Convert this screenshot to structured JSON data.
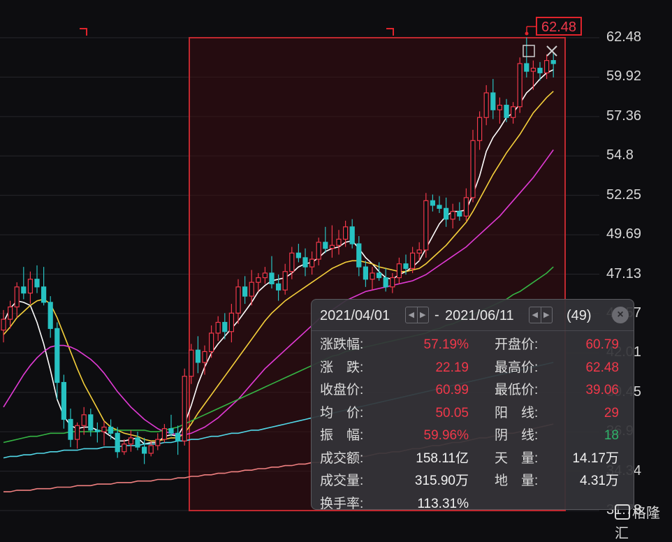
{
  "chart_data": {
    "type": "candlestick",
    "y_axis_ticks": [
      "62.48",
      "59.92",
      "57.36",
      "54.8",
      "52.25",
      "49.69",
      "47.13",
      "44.57",
      "42.01",
      "39.45",
      "36.9",
      "34.34",
      "31.78"
    ],
    "ylim": [
      31.78,
      62.48
    ],
    "max_marker": "62.48",
    "selection_range": {
      "start": "2021/04/01",
      "end": "2021/06/11"
    },
    "candles": [
      [
        43.5,
        44.8,
        42.7,
        44.2
      ],
      [
        44.2,
        45.4,
        43.6,
        45.0
      ],
      [
        45.0,
        46.6,
        44.3,
        46.3
      ],
      [
        46.3,
        47.6,
        45.5,
        45.9
      ],
      [
        45.9,
        47.3,
        45.2,
        46.8
      ],
      [
        46.8,
        47.7,
        45.9,
        46.3
      ],
      [
        46.3,
        47.6,
        45.1,
        45.3
      ],
      [
        45.3,
        45.7,
        43.0,
        43.6
      ],
      [
        43.6,
        44.0,
        39.0,
        40.1
      ],
      [
        40.1,
        40.6,
        37.1,
        37.7
      ],
      [
        37.7,
        38.4,
        35.9,
        36.4
      ],
      [
        36.4,
        37.5,
        35.8,
        37.3
      ],
      [
        37.3,
        38.5,
        36.7,
        38.0
      ],
      [
        38.0,
        38.4,
        36.6,
        37.0
      ],
      [
        37.0,
        37.5,
        36.2,
        36.9
      ],
      [
        36.9,
        37.6,
        36.0,
        37.2
      ],
      [
        37.2,
        37.7,
        36.4,
        36.8
      ],
      [
        36.8,
        37.2,
        35.2,
        35.6
      ],
      [
        35.6,
        36.4,
        35.4,
        36.1
      ],
      [
        36.1,
        37.0,
        35.6,
        36.5
      ],
      [
        36.5,
        36.9,
        35.7,
        35.9
      ],
      [
        35.9,
        36.5,
        34.8,
        35.5
      ],
      [
        35.5,
        36.3,
        35.3,
        36.0
      ],
      [
        36.0,
        36.8,
        35.7,
        36.4
      ],
      [
        36.4,
        37.4,
        36.2,
        37.1
      ],
      [
        37.1,
        38.0,
        36.6,
        36.8
      ],
      [
        36.8,
        37.3,
        35.4,
        36.3
      ],
      [
        36.3,
        41.0,
        36.0,
        40.5
      ],
      [
        40.5,
        42.6,
        40.0,
        42.2
      ],
      [
        42.2,
        43.1,
        40.7,
        41.4
      ],
      [
        41.4,
        42.5,
        40.6,
        42.1
      ],
      [
        42.1,
        43.8,
        41.7,
        43.3
      ],
      [
        43.3,
        44.4,
        42.8,
        44.0
      ],
      [
        44.0,
        44.6,
        42.9,
        43.4
      ],
      [
        43.4,
        45.2,
        42.7,
        44.6
      ],
      [
        44.6,
        46.8,
        43.9,
        46.3
      ],
      [
        46.3,
        47.0,
        45.2,
        45.7
      ],
      [
        45.7,
        47.4,
        45.1,
        46.6
      ],
      [
        46.6,
        47.2,
        46.0,
        46.9
      ],
      [
        46.9,
        47.6,
        46.5,
        47.2
      ],
      [
        47.2,
        48.3,
        46.2,
        46.5
      ],
      [
        46.5,
        47.1,
        45.4,
        46.1
      ],
      [
        46.1,
        47.8,
        45.8,
        47.3
      ],
      [
        47.3,
        48.9,
        46.8,
        48.5
      ],
      [
        48.5,
        49.1,
        47.9,
        48.2
      ],
      [
        48.2,
        48.8,
        47.0,
        47.6
      ],
      [
        47.6,
        48.6,
        47.1,
        48.1
      ],
      [
        48.1,
        49.5,
        47.7,
        49.2
      ],
      [
        49.2,
        50.2,
        48.5,
        48.8
      ],
      [
        48.8,
        50.3,
        48.2,
        49.0
      ],
      [
        49.0,
        50.0,
        48.4,
        49.4
      ],
      [
        49.4,
        50.6,
        48.9,
        50.2
      ],
      [
        50.2,
        50.7,
        48.8,
        49.1
      ],
      [
        49.1,
        49.6,
        47.0,
        47.6
      ],
      [
        47.6,
        48.0,
        46.3,
        46.8
      ],
      [
        46.8,
        47.6,
        46.1,
        47.2
      ],
      [
        47.2,
        47.9,
        46.7,
        46.9
      ],
      [
        46.9,
        47.5,
        46.0,
        46.3
      ],
      [
        46.3,
        47.2,
        45.9,
        46.9
      ],
      [
        46.9,
        48.2,
        46.5,
        47.8
      ],
      [
        47.8,
        48.4,
        47.1,
        47.5
      ],
      [
        47.5,
        48.9,
        47.2,
        48.5
      ],
      [
        48.5,
        49.2,
        48.0,
        48.7
      ],
      [
        48.7,
        52.4,
        48.2,
        51.9
      ],
      [
        51.9,
        52.3,
        51.2,
        51.6
      ],
      [
        51.6,
        52.2,
        51.1,
        51.4
      ],
      [
        51.4,
        52.1,
        50.2,
        50.7
      ],
      [
        50.7,
        51.7,
        50.1,
        51.2
      ],
      [
        51.2,
        51.8,
        50.6,
        50.9
      ],
      [
        50.9,
        52.7,
        50.6,
        52.1
      ],
      [
        52.1,
        56.5,
        51.8,
        55.8
      ],
      [
        55.8,
        57.7,
        55.2,
        57.3
      ],
      [
        57.3,
        59.4,
        56.8,
        58.9
      ],
      [
        58.9,
        59.8,
        57.2,
        57.8
      ],
      [
        57.8,
        58.6,
        56.9,
        58.1
      ],
      [
        58.1,
        58.5,
        57.0,
        57.3
      ],
      [
        57.3,
        58.3,
        56.9,
        58.0
      ],
      [
        58.0,
        61.2,
        57.6,
        60.8
      ],
      [
        60.8,
        62.5,
        59.9,
        60.3
      ],
      [
        60.3,
        61.0,
        59.1,
        60.5
      ],
      [
        60.5,
        60.9,
        59.7,
        60.2
      ],
      [
        60.2,
        61.4,
        59.8,
        61.0
      ],
      [
        61.0,
        61.5,
        59.9,
        60.8
      ]
    ],
    "ma_lines": [
      {
        "color": "#ffffff",
        "values": [
          44.0,
          44.9,
          45.4,
          45.3,
          45.1,
          44.0,
          42.6,
          40.9,
          39.0,
          37.9,
          37.3,
          37.1,
          37.2,
          37.2,
          37.0,
          36.9,
          36.6,
          36.3,
          36.3,
          36.4,
          36.5,
          36.1,
          36.2,
          36.2,
          36.6,
          36.7,
          36.6,
          37.4,
          38.6,
          40.0,
          41.1,
          42.0,
          42.6,
          43.1,
          43.6,
          44.1,
          44.7,
          45.3,
          46.0,
          46.4,
          46.7,
          46.8,
          46.9,
          47.2,
          47.6,
          47.8,
          47.9,
          48.2,
          48.6,
          48.8,
          48.9,
          49.2,
          49.3,
          48.8,
          48.2,
          47.8,
          47.3,
          46.9,
          46.8,
          47.1,
          47.3,
          47.6,
          48.0,
          48.8,
          49.6,
          50.4,
          50.9,
          51.2,
          51.2,
          51.3,
          52.3,
          53.5,
          55.1,
          56.0,
          56.6,
          57.3,
          57.6,
          58.2,
          58.9,
          59.3,
          59.8,
          60.2,
          60.4
        ]
      },
      {
        "color": "#f5d03b",
        "values": [
          43.2,
          43.7,
          44.3,
          44.7,
          45.1,
          45.4,
          45.5,
          45.2,
          44.3,
          43.2,
          42.1,
          41.0,
          40.0,
          39.2,
          38.4,
          37.6,
          37.2,
          37.0,
          36.8,
          36.7,
          36.6,
          36.4,
          36.3,
          36.3,
          36.4,
          36.5,
          36.5,
          36.8,
          37.4,
          38.1,
          38.7,
          39.3,
          39.9,
          40.5,
          41.1,
          41.7,
          42.3,
          42.9,
          43.5,
          44.1,
          44.6,
          45.0,
          45.4,
          45.7,
          46.0,
          46.3,
          46.6,
          46.9,
          47.2,
          47.5,
          47.7,
          47.9,
          48.0,
          48.0,
          47.9,
          47.8,
          47.6,
          47.5,
          47.4,
          47.3,
          47.3,
          47.4,
          47.5,
          47.8,
          48.2,
          48.6,
          49.0,
          49.5,
          50.0,
          50.5,
          51.2,
          52.0,
          52.8,
          53.6,
          54.3,
          55.0,
          55.6,
          56.2,
          56.9,
          57.6,
          58.1,
          58.6,
          59.0
        ]
      },
      {
        "color": "#e03ad4",
        "values": [
          38.5,
          39.2,
          39.9,
          40.6,
          41.2,
          41.7,
          42.1,
          42.4,
          42.5,
          42.5,
          42.4,
          42.2,
          41.9,
          41.6,
          41.2,
          40.7,
          40.1,
          39.5,
          39.0,
          38.5,
          38.1,
          37.7,
          37.4,
          37.1,
          36.9,
          36.8,
          36.7,
          36.7,
          36.8,
          37.0,
          37.2,
          37.5,
          37.8,
          38.2,
          38.6,
          39.0,
          39.5,
          40.0,
          40.5,
          41.0,
          41.4,
          41.8,
          42.2,
          42.6,
          43.0,
          43.4,
          43.8,
          44.2,
          44.5,
          44.8,
          45.1,
          45.4,
          45.6,
          45.8,
          46.0,
          46.1,
          46.2,
          46.3,
          46.4,
          46.5,
          46.6,
          46.7,
          46.9,
          47.1,
          47.4,
          47.7,
          48.0,
          48.3,
          48.6,
          48.9,
          49.3,
          49.7,
          50.1,
          50.5,
          50.9,
          51.4,
          51.9,
          52.4,
          52.9,
          53.4,
          54.0,
          54.6,
          55.2
        ]
      },
      {
        "color": "#35b544",
        "values": [
          36.2,
          36.3,
          36.4,
          36.5,
          36.6,
          36.6,
          36.7,
          36.8,
          36.8,
          36.8,
          36.9,
          36.9,
          36.9,
          36.9,
          36.9,
          37.0,
          37.0,
          37.0,
          37.0,
          37.0,
          37.0,
          37.0,
          36.9,
          36.9,
          37.0,
          37.1,
          37.2,
          37.4,
          37.6,
          37.8,
          38.0,
          38.2,
          38.4,
          38.6,
          38.8,
          39.0,
          39.2,
          39.4,
          39.6,
          39.8,
          40.0,
          40.2,
          40.4,
          40.6,
          40.8,
          41.0,
          41.2,
          41.4,
          41.6,
          41.8,
          41.9,
          42.1,
          42.2,
          42.3,
          42.4,
          42.5,
          42.6,
          42.7,
          42.8,
          42.9,
          43.0,
          43.1,
          43.2,
          43.3,
          43.5,
          43.6,
          43.8,
          43.9,
          44.1,
          44.3,
          44.5,
          44.7,
          44.9,
          45.1,
          45.3,
          45.5,
          45.8,
          46.0,
          46.3,
          46.6,
          46.9,
          47.2,
          47.6
        ]
      },
      {
        "color": "#52d8e8",
        "values": [
          35.2,
          35.3,
          35.3,
          35.4,
          35.4,
          35.5,
          35.5,
          35.6,
          35.6,
          35.7,
          35.7,
          35.7,
          35.8,
          35.8,
          35.8,
          35.9,
          35.9,
          35.9,
          36.0,
          36.0,
          36.0,
          36.1,
          36.1,
          36.1,
          36.2,
          36.2,
          36.3,
          36.3,
          36.4,
          36.4,
          36.5,
          36.6,
          36.6,
          36.7,
          36.8,
          36.8,
          36.9,
          37.0,
          37.0,
          37.1,
          37.2,
          37.3,
          37.4,
          37.5,
          37.6,
          37.7,
          37.8,
          37.9,
          38.0,
          38.1,
          38.2,
          38.3,
          38.4,
          38.5,
          38.6,
          38.7,
          38.8,
          38.9,
          39.0,
          39.1,
          39.2,
          39.3,
          39.4,
          39.5,
          39.6,
          39.7,
          39.8,
          39.9,
          40.0,
          40.1,
          40.2,
          40.3,
          40.4,
          40.5,
          40.6,
          40.7,
          40.8,
          40.9,
          41.0,
          41.1,
          41.2,
          41.3,
          41.4
        ]
      },
      {
        "color": "#f08080",
        "values": [
          33.0,
          33.0,
          33.1,
          33.1,
          33.1,
          33.2,
          33.2,
          33.2,
          33.3,
          33.3,
          33.3,
          33.4,
          33.4,
          33.4,
          33.5,
          33.5,
          33.5,
          33.6,
          33.6,
          33.6,
          33.7,
          33.7,
          33.7,
          33.8,
          33.8,
          33.8,
          33.9,
          33.9,
          34.0,
          34.0,
          34.1,
          34.1,
          34.2,
          34.2,
          34.3,
          34.3,
          34.4,
          34.4,
          34.5,
          34.5,
          34.6,
          34.6,
          34.7,
          34.7,
          34.8,
          34.8,
          34.9,
          34.9,
          35.0,
          35.0,
          35.1,
          35.2,
          35.2,
          35.3,
          35.3,
          35.4,
          35.5,
          35.5,
          35.6,
          35.6,
          35.7,
          35.8,
          35.8,
          35.9,
          36.0,
          36.0,
          36.1,
          36.2,
          36.2,
          36.3,
          36.4,
          36.5,
          36.5,
          36.6,
          36.7,
          36.8,
          36.8,
          36.9,
          37.0,
          37.1,
          37.2,
          37.3,
          37.4
        ]
      }
    ]
  },
  "stats_panel": {
    "date_start": "2021/04/01",
    "date_sep": "-",
    "date_end": "2021/06/11",
    "count": "(49)",
    "close_glyph": "×",
    "rows": [
      {
        "l1": "涨跌幅:",
        "v1": "57.19%",
        "l2": "开盘价:",
        "v2": "60.79"
      },
      {
        "l1": "涨　跌:",
        "v1": "22.19",
        "l2": "最高价:",
        "v2": "62.48"
      },
      {
        "l1": "收盘价:",
        "v1": "60.99",
        "l2": "最低价:",
        "v2": "39.06"
      },
      {
        "l1": "均　价:",
        "v1": "50.05",
        "l2": "阳　线:",
        "v2": "29"
      },
      {
        "l1": "振　幅:",
        "v1": "59.96%",
        "l2": "阴　线:",
        "v2": "18"
      },
      {
        "l1": "成交额:",
        "v1": "158.11亿",
        "l2": "天　量:",
        "v2": "14.17万"
      },
      {
        "l1": "成交量:",
        "v1": "315.90万",
        "l2": "地　量:",
        "v2": "4.31万"
      },
      {
        "l1": "换手率:",
        "v1": "113.31%",
        "l2": "",
        "v2": ""
      }
    ]
  },
  "watermark": "格隆汇",
  "colors": {
    "up": "#f0384a",
    "down": "#27c2c2",
    "selection": "#c0282f",
    "green": "#2fb36a"
  }
}
